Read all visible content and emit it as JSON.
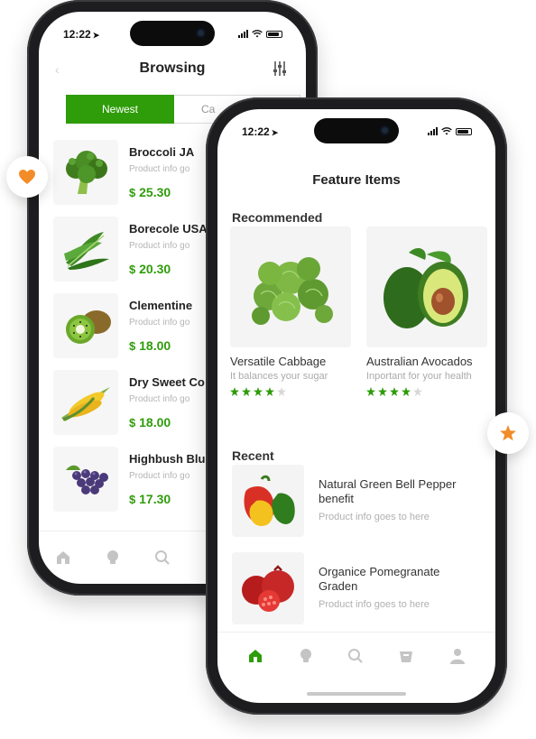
{
  "back_screen": {
    "status_time": "12:22",
    "title": "Browsing",
    "segment": {
      "active_label": "Newest",
      "inactive_label": "Ca"
    },
    "products": [
      {
        "name": "Broccoli JA",
        "info": "Product info go",
        "currency": "$",
        "price": "25.30",
        "icon": "broccoli-image"
      },
      {
        "name": "Borecole USA",
        "info": "Product info go",
        "currency": "$",
        "price": "20.30",
        "icon": "borecole-image"
      },
      {
        "name": "Clementine",
        "info": "Product info go",
        "currency": "$",
        "price": "18.00",
        "icon": "kiwi-image"
      },
      {
        "name": "Dry Sweet Co",
        "info": "Product info go",
        "currency": "$",
        "price": "18.00",
        "icon": "corn-image"
      },
      {
        "name": "Highbush Blu",
        "info": "Product info go",
        "currency": "$",
        "price": "17.30",
        "icon": "grapes-image"
      }
    ],
    "tabbar": [
      "home-icon",
      "lightbulb-icon",
      "search-icon"
    ]
  },
  "front_screen": {
    "status_time": "12:22",
    "title": "Feature Items",
    "recommended_title": "Recommended",
    "recommended": [
      {
        "name": "Versatile Cabbage",
        "subtitle": "It balances your sugar",
        "rating": 4,
        "max_rating": 5,
        "icon": "brussels-sprouts-image"
      },
      {
        "name": "Australian Avocados",
        "subtitle": "Inportant for your health",
        "rating": 4,
        "max_rating": 5,
        "icon": "avocado-image"
      }
    ],
    "recent_title": "Recent",
    "recent": [
      {
        "name": "Natural Green Bell Pepper benefit",
        "subtitle": "Product info goes to here",
        "icon": "bell-pepper-image"
      },
      {
        "name": "Organice Pomegranate Graden",
        "subtitle": "Product info goes to here",
        "icon": "pomegranate-image"
      }
    ],
    "tabbar": [
      "home-icon",
      "lightbulb-icon",
      "search-icon",
      "basket-icon",
      "user-icon"
    ],
    "active_tab": "home-icon"
  },
  "colors": {
    "accent_green": "#2f9c0a",
    "badge_orange": "#f28c28"
  },
  "floating_badges": [
    "heart-icon",
    "star-icon"
  ]
}
